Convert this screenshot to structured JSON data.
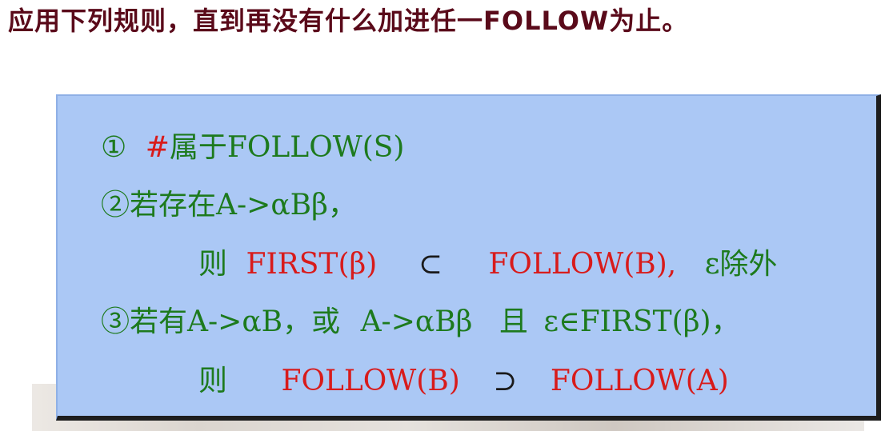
{
  "heading": "应用下列规则，直到再没有什么加进任一FOLLOW为止。",
  "rules": {
    "r1": {
      "num": "①",
      "hash": "#",
      "text": "属于FOLLOW(S)"
    },
    "r2": {
      "num": "②",
      "text": "若存在A->αBβ，"
    },
    "r2b": {
      "then": "则",
      "first": "FIRST(β)",
      "subset": "⊂",
      "follow": "FOLLOW(B),",
      "except": "ε除外"
    },
    "r3": {
      "num": "③",
      "text1": "若有A->αB，或",
      "text2": "A->αBβ",
      "and": "且",
      "cond": "ε∈FIRST(β)，"
    },
    "r3b": {
      "then": "则",
      "follow_b": "FOLLOW(B)",
      "superset": "⊃",
      "follow_a": "FOLLOW(A)"
    }
  }
}
